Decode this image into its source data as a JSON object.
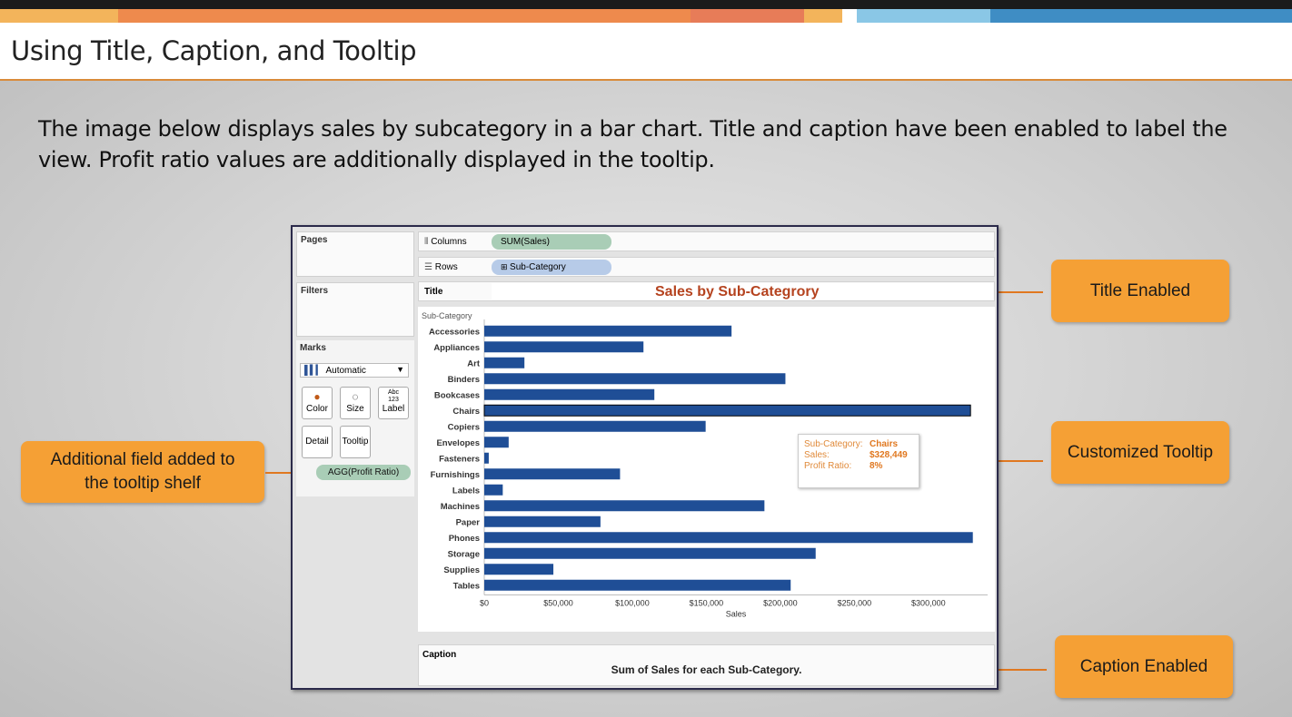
{
  "slide": {
    "title": "Using Title, Caption, and Tooltip",
    "intro": "The image below displays sales by subcategory in a bar chart. Title and caption have been enabled to label the view. Profit ratio values are additionally displayed in the tooltip."
  },
  "callouts": {
    "title_enabled": "Title Enabled",
    "customized_tooltip": "Customized Tooltip",
    "caption_enabled": "Caption Enabled",
    "additional_field_line1": "Additional field added to",
    "additional_field_line2": "the tooltip shelf"
  },
  "tableau": {
    "panels": {
      "pages": "Pages",
      "filters": "Filters",
      "marks": "Marks"
    },
    "mark_type": "Automatic",
    "mark_buttons": {
      "color": "Color",
      "size": "Size",
      "label": "Label",
      "detail": "Detail",
      "tooltip": "Tooltip",
      "label_icon_line1": "Abc",
      "label_icon_line2": "123"
    },
    "tooltip_pill": "AGG(Profit Ratio)",
    "columns": {
      "label": "Columns",
      "pill": "SUM(Sales)"
    },
    "rows": {
      "label": "Rows",
      "pill": "Sub-Category"
    },
    "title_label": "Title",
    "caption_label": "Caption",
    "caption_text": "Sum of Sales for each Sub-Category.",
    "tooltip": {
      "k1": "Sub-Category:",
      "v1": "Chairs",
      "k2": "Sales:",
      "v2": "$328,449",
      "k3": "Profit Ratio:",
      "v3": "8%"
    }
  },
  "colors": {
    "bar": "#1f4e96",
    "accent": "#f5a035",
    "title_red": "#b5431f"
  },
  "chart_data": {
    "type": "bar",
    "orientation": "horizontal",
    "title": "Sales by Sub-Categrory",
    "row_header": "Sub-Category",
    "xlabel": "Sales",
    "xlim": [
      0,
      340000
    ],
    "xticks": [
      0,
      50000,
      100000,
      150000,
      200000,
      250000,
      300000
    ],
    "xtick_labels": [
      "$0",
      "$50,000",
      "$100,000",
      "$150,000",
      "$200,000",
      "$250,000",
      "$300,000"
    ],
    "categories": [
      "Accessories",
      "Appliances",
      "Art",
      "Binders",
      "Bookcases",
      "Chairs",
      "Copiers",
      "Envelopes",
      "Fasteners",
      "Furnishings",
      "Labels",
      "Machines",
      "Paper",
      "Phones",
      "Storage",
      "Supplies",
      "Tables"
    ],
    "values": [
      167026,
      107532,
      27119,
      203413,
      114880,
      328449,
      149528,
      16476,
      3024,
      91705,
      12486,
      189239,
      78479,
      330007,
      223844,
      46674,
      206966
    ]
  }
}
